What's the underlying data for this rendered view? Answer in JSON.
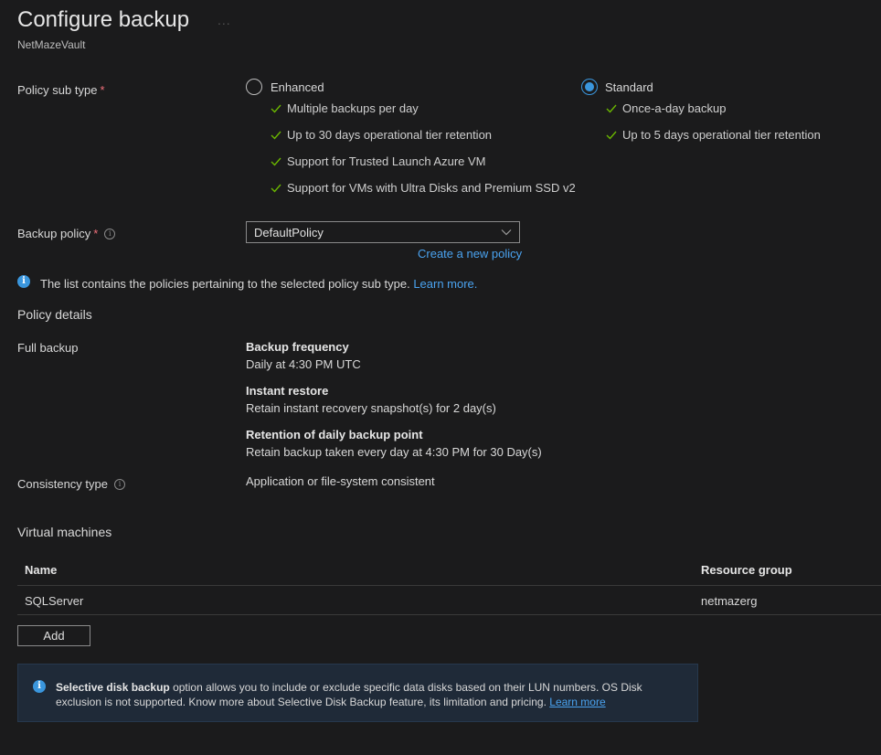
{
  "header": {
    "title": "Configure backup",
    "title_more": "...",
    "subtitle": "NetMazeVault"
  },
  "policy_sub_type": {
    "label": "Policy sub type",
    "required_mark": "*",
    "options": [
      {
        "label": "Enhanced",
        "selected": false,
        "features": [
          "Multiple backups per day",
          "Up to 30 days operational tier retention",
          "Support for Trusted Launch Azure VM",
          "Support for VMs with Ultra Disks and Premium SSD v2"
        ]
      },
      {
        "label": "Standard",
        "selected": true,
        "features": [
          "Once-a-day backup",
          "Up to 5 days operational tier retention"
        ]
      }
    ]
  },
  "backup_policy": {
    "label": "Backup policy",
    "required_mark": "*",
    "info_icon": "i",
    "value": "DefaultPolicy",
    "create_link": "Create a new policy"
  },
  "info_note": {
    "icon": "i",
    "text": "The list contains the policies pertaining to the selected policy sub type.",
    "link": "Learn more."
  },
  "policy_details": {
    "heading": "Policy details",
    "full_backup_label": "Full backup",
    "items": [
      {
        "title": "Backup frequency",
        "value": "Daily at 4:30 PM UTC"
      },
      {
        "title": "Instant restore",
        "value": "Retain instant recovery snapshot(s) for 2 day(s)"
      },
      {
        "title": "Retention of daily backup point",
        "value": "Retain backup taken every day at 4:30 PM for 30 Day(s)"
      }
    ],
    "consistency_label": "Consistency type",
    "consistency_info_icon": "i",
    "consistency_value": "Application or file-system consistent"
  },
  "virtual_machines": {
    "heading": "Virtual machines",
    "columns": [
      "Name",
      "Resource group"
    ],
    "rows": [
      {
        "name": "SQLServer",
        "resource_group": "netmazerg"
      }
    ],
    "add_button": "Add"
  },
  "banner": {
    "icon": "i",
    "bold": "Selective disk backup",
    "text": " option allows you to include or exclude specific data disks based on their LUN numbers. OS Disk exclusion is not supported. Know more about Selective Disk Backup feature, its limitation and pricing. ",
    "link": "Learn more"
  },
  "colors": {
    "background": "#1b1b1c",
    "accent": "#3a96dd",
    "link": "#4aa3f0",
    "check": "#6bb700",
    "required": "#f1707b",
    "banner_bg": "#1f2a38"
  }
}
